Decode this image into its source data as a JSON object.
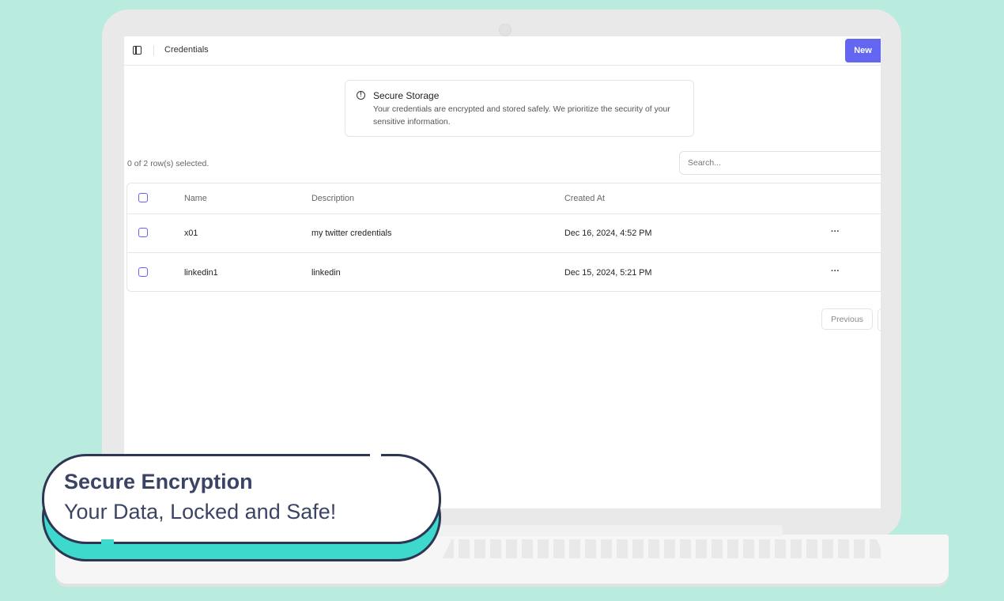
{
  "topbar": {
    "breadcrumb": "Credentials",
    "new_button": "New"
  },
  "alert": {
    "title": "Secure Storage",
    "body": "Your credentials are encrypted and stored safely. We prioritize the security of your sensitive information."
  },
  "table_controls": {
    "selection_count": "0 of 2 row(s) selected.",
    "search_placeholder": "Search..."
  },
  "table": {
    "columns": [
      "Name",
      "Description",
      "Created At"
    ],
    "rows": [
      {
        "name": "x01",
        "description": "my twitter credentials",
        "created_at": "Dec 16, 2024, 4:52 PM",
        "actions": "···"
      },
      {
        "name": "linkedin1",
        "description": "linkedin",
        "created_at": "Dec 15, 2024, 5:21 PM",
        "actions": "···"
      }
    ]
  },
  "pagination": {
    "previous": "Previous"
  },
  "callout": {
    "title": "Secure Encryption",
    "subtitle": "Your Data, Locked and Safe!"
  },
  "colors": {
    "background": "#b9ebdf",
    "accent": "#6366f1",
    "callout_text": "#3c4466",
    "callout_accent": "#3dd9cc"
  }
}
